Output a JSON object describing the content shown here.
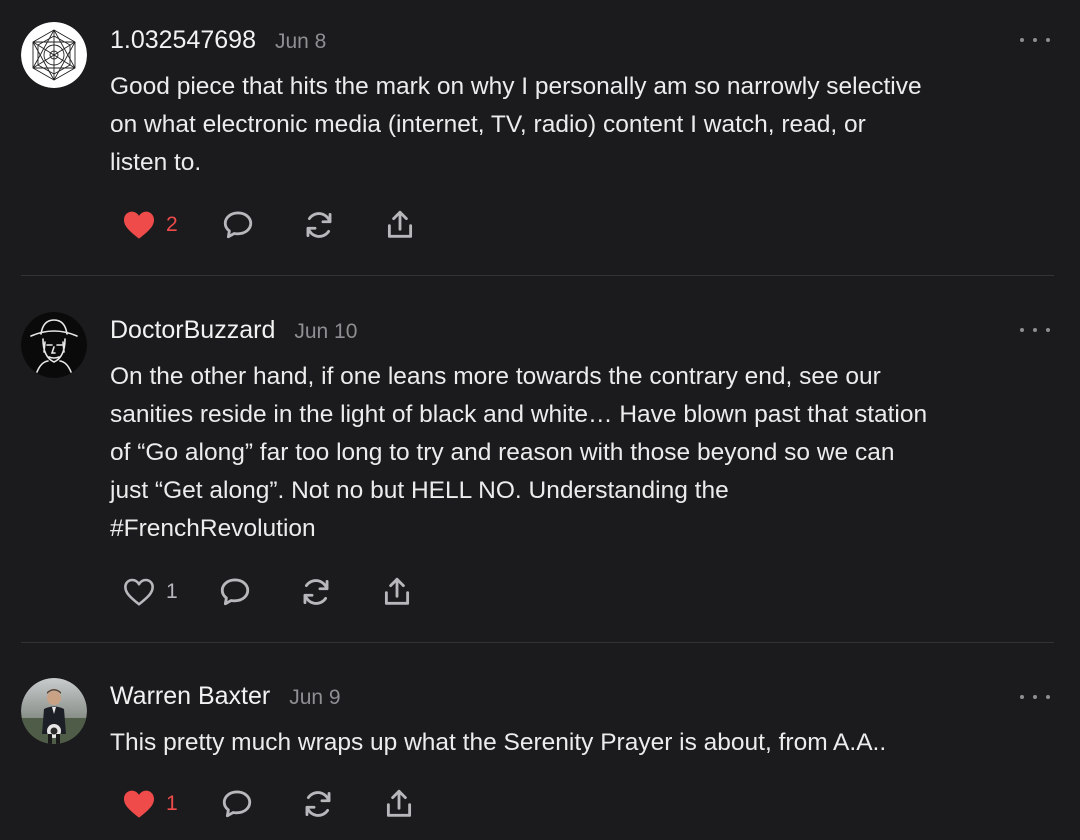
{
  "colors": {
    "background": "#1b1b1d",
    "text": "#ececec",
    "muted": "#8e8e93",
    "liked": "#ef4b4b",
    "icon": "#b8b8bc",
    "divider": "#333336"
  },
  "comments": [
    {
      "author": "1.032547698",
      "date": "Jun 8",
      "avatar_icon": "geometric-mandala-avatar",
      "body_lines": [
        "Good piece that hits the mark on why I personally am so narrowly selective",
        "on what electronic media (internet, TV, radio) content I watch, read, or",
        "listen to."
      ],
      "like_count": "2",
      "liked": true
    },
    {
      "author": "DoctorBuzzard",
      "date": "Jun 10",
      "avatar_icon": "hat-sketch-avatar",
      "body_lines": [
        "On the other hand, if one leans more towards the contrary end, see our",
        "sanities reside in the light of black and white… Have blown past that station",
        "of “Go along” far too long to try and reason with those beyond so we can",
        "just “Get along”. Not no but HELL NO. Understanding the",
        "#FrenchRevolution"
      ],
      "like_count": "1",
      "liked": false
    },
    {
      "author": "Warren Baxter",
      "date": "Jun 9",
      "avatar_icon": "person-photo-avatar",
      "body_lines": [
        "This pretty much wraps up what the Serenity Prayer is about, from A.A.."
      ],
      "like_count": "1",
      "liked": true
    }
  ],
  "action_icons": [
    "heart-icon",
    "comment-bubble-icon",
    "restack-icon",
    "share-icon"
  ],
  "more_icon": "more-options-icon"
}
